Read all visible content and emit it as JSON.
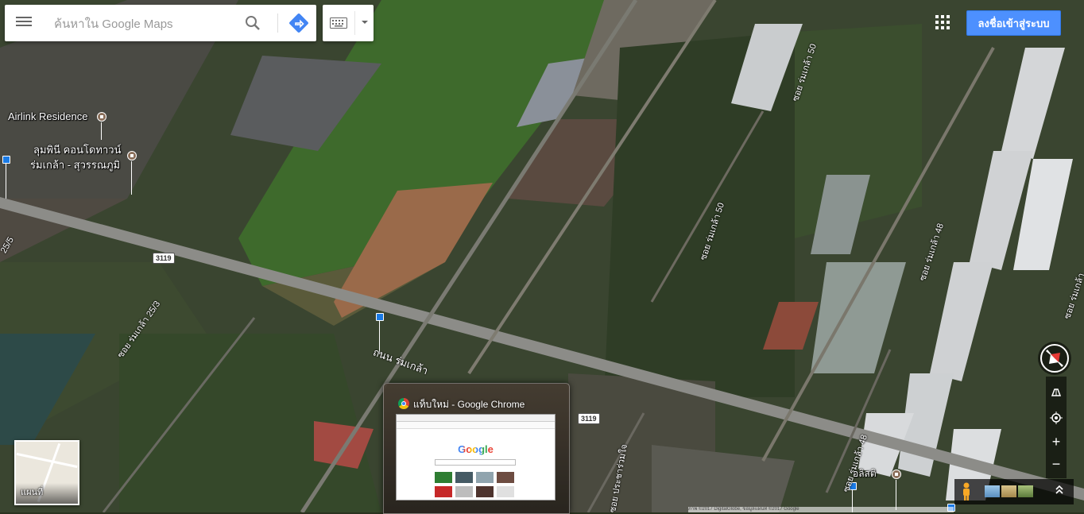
{
  "search": {
    "placeholder": "ค้นหาใน Google Maps"
  },
  "header": {
    "signin_label": "ลงชื่อเข้าสู่ระบบ"
  },
  "map_labels": {
    "airlink": "Airlink Residence",
    "lumpini_line1": "ลุมพินี คอนโดทาวน์",
    "lumpini_line2": "ร่มเกล้า - สุวรรณภูมิ",
    "road_main": "ถนน ร่มเกล้า",
    "soi_25_3": "ซอย ร่มเกล้า 25/3",
    "soi_25_5": "25/5",
    "soi_50_top": "ซอย ร่มเกล้า 50",
    "soi_50_mid": "ซอย ร่มเกล้า 50",
    "soi_48_top": "ซอย ร่มเกล้า 48",
    "soi_48_bottom": "ซอย ร่มเกล้า 48",
    "soi_right": "ซอย ร่มเกล้า",
    "soi_pracha": "ซอย ประชาร่วมใจ",
    "oliese": "อลิสติ",
    "route_1": "3119",
    "route_2": "3119"
  },
  "minimap": {
    "label": "แผนที่"
  },
  "task_preview": {
    "title": "แท็บใหม่ - Google Chrome",
    "logo_text": "Google"
  },
  "attribution": {
    "text": "ภาพ ©2017 DigitalGlobe, ข้อมูลแผนที่ ©2017 Google"
  },
  "colors": {
    "signin_bg": "#4d90fe",
    "direction_blue": "#4285f4",
    "transit_blue": "#1a7be6"
  }
}
